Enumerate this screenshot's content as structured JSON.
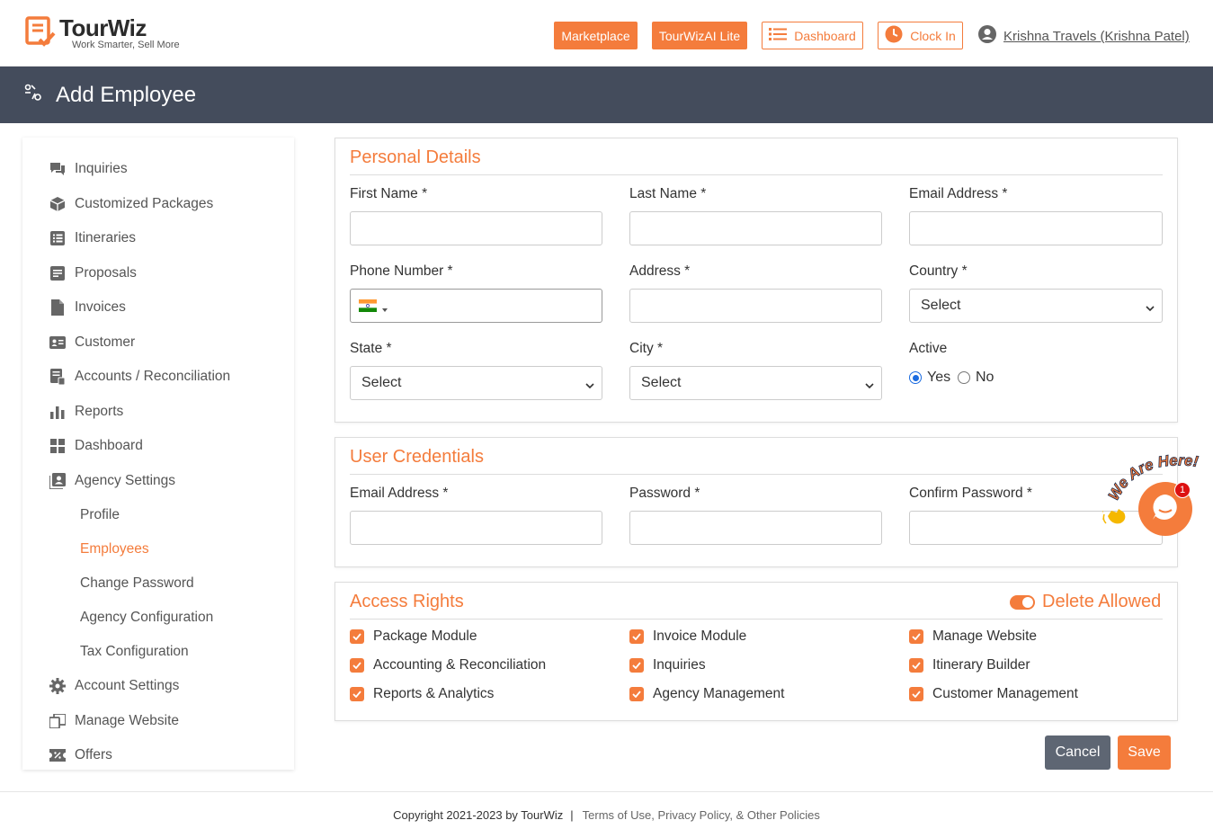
{
  "app": {
    "logo_title": "TourWiz",
    "logo_tagline": "Work Smarter, Sell More",
    "brand_color": "#f47c3c",
    "header_bg": "#444c5c"
  },
  "topnav": {
    "marketplace": "Marketplace",
    "tourwiz_lite": "TourWizAI Lite",
    "dashboard": "Dashboard",
    "clock_in": "Clock In",
    "user_name": "Krishna Travels (Krishna Patel)"
  },
  "page": {
    "title": "Add Employee"
  },
  "sidebar": {
    "items": [
      {
        "label": "Inquiries",
        "icon": "chat-icon"
      },
      {
        "label": "Customized Packages",
        "icon": "package-icon"
      },
      {
        "label": "Itineraries",
        "icon": "list-icon"
      },
      {
        "label": "Proposals",
        "icon": "document-icon"
      },
      {
        "label": "Invoices",
        "icon": "file-icon"
      },
      {
        "label": "Customer",
        "icon": "id-card-icon"
      },
      {
        "label": "Accounts / Reconciliation",
        "icon": "ledger-icon"
      },
      {
        "label": "Reports",
        "icon": "bar-chart-icon"
      },
      {
        "label": "Dashboard",
        "icon": "grid-icon"
      },
      {
        "label": "Agency Settings",
        "icon": "profile-card-icon"
      }
    ],
    "sub_items": [
      {
        "label": "Profile",
        "active": false
      },
      {
        "label": "Employees",
        "active": true
      },
      {
        "label": "Change Password",
        "active": false
      },
      {
        "label": "Agency Configuration",
        "active": false
      },
      {
        "label": "Tax Configuration",
        "active": false
      }
    ],
    "bottom_items": [
      {
        "label": "Account Settings",
        "icon": "gear-icon"
      },
      {
        "label": "Manage Website",
        "icon": "website-icon"
      },
      {
        "label": "Offers",
        "icon": "ticket-icon"
      }
    ]
  },
  "personal": {
    "title": "Personal Details",
    "first_name_label": "First Name *",
    "last_name_label": "Last Name *",
    "email_label": "Email Address *",
    "phone_label": "Phone Number *",
    "address_label": "Address *",
    "country_label": "Country *",
    "country_value": "Select",
    "state_label": "State *",
    "state_value": "Select",
    "city_label": "City *",
    "city_value": "Select",
    "active_label": "Active",
    "yes_label": "Yes",
    "no_label": "No",
    "active_value": "Yes"
  },
  "credentials": {
    "title": "User Credentials",
    "email_label": "Email Address *",
    "password_label": "Password *",
    "confirm_label": "Confirm Password *"
  },
  "access": {
    "title": "Access Rights",
    "delete_allowed": "Delete Allowed",
    "rights": [
      {
        "label": "Package Module",
        "checked": true
      },
      {
        "label": "Invoice Module",
        "checked": true
      },
      {
        "label": "Manage Website",
        "checked": true
      },
      {
        "label": "Accounting & Reconciliation",
        "checked": true
      },
      {
        "label": "Inquiries",
        "checked": true
      },
      {
        "label": "Itinerary Builder",
        "checked": true
      },
      {
        "label": "Reports & Analytics",
        "checked": true
      },
      {
        "label": "Agency Management",
        "checked": true
      },
      {
        "label": "Customer Management",
        "checked": true
      }
    ]
  },
  "actions": {
    "cancel": "Cancel",
    "save": "Save"
  },
  "footer": {
    "copyright": "Copyright 2021-2023 by TourWiz",
    "separator": "|",
    "links": "Terms of Use, Privacy Policy, & Other Policies"
  },
  "chat": {
    "caption": "We Are Here!",
    "badge": "1"
  }
}
